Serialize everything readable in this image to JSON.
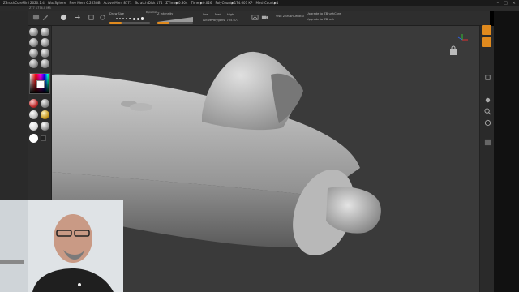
{
  "titlebar": {
    "app": "ZBrushCoreMini 2020.1.4",
    "document": "WaxSphere",
    "free_mem": "Free Mem 6.263GB",
    "active_mem": "Active Mem 8771",
    "scratch_disk": "Scratch Disk 174",
    "ztime": "ZTime▶0.804",
    "timer": "Timer▶0.026",
    "polycount": "PolyCount▶174.607 KP",
    "meshcount": "MeshCount▶1"
  },
  "subbar": {
    "label": "ZT7 1774.0 MB"
  },
  "toolbar": {
    "draw_size_label": "Draw Size",
    "draw_size_value": "Dynamic",
    "symmetry_label": "Z Intensity",
    "low_label": "Low",
    "med_label": "Med",
    "high_label": "High",
    "active_polygons": "ActivePolygons: 705.673",
    "view_zbrushcentral": "Visit ZBrushCentral",
    "upgrade_core": "Upgrade to ZBrushCore",
    "upgrade_zbrush": "Upgrade to ZBrush",
    "draw_size_fraction": 0.3,
    "intensity_fraction": 0.35
  },
  "colors": {
    "accent": "#e08a1e",
    "canvas": "#3a3a3a",
    "panel": "#2e2e2e"
  },
  "icons": {
    "brushes": [
      "standard-brush",
      "clay-buildup-brush",
      "move-brush",
      "smooth-brush",
      "inflate-brush",
      "pinch-brush",
      "dam-standard-brush",
      "trim-brush"
    ],
    "materials": [
      "matcap-red",
      "matcap-gray",
      "matcap-white",
      "matcap-gold",
      "matcap-skin",
      "matcap-chrome",
      "matcap-basic",
      "matcap-flat"
    ]
  }
}
